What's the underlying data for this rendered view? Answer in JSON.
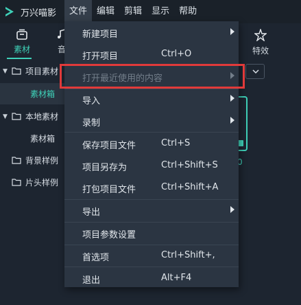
{
  "app": {
    "title": "万兴喵影",
    "logo_icon": "app-logo-icon"
  },
  "menubar": {
    "items": [
      {
        "label": "文件",
        "active": true
      },
      {
        "label": "编辑"
      },
      {
        "label": "剪辑"
      },
      {
        "label": "显示"
      },
      {
        "label": "帮助"
      }
    ]
  },
  "toolbar": {
    "tabs": [
      {
        "label": "素材",
        "icon": "media-box-icon",
        "active": true
      },
      {
        "label": "音",
        "icon": "music-note-icon"
      },
      {
        "label": "特效",
        "icon": "effects-star-icon"
      }
    ]
  },
  "sidebar": {
    "items": [
      {
        "label": "项目素材",
        "type": "parent"
      },
      {
        "label": "素材箱",
        "type": "child",
        "selected": true
      },
      {
        "label": "本地素材",
        "type": "parent"
      },
      {
        "label": "素材箱",
        "type": "child"
      },
      {
        "label": "背景样例",
        "type": "folder"
      },
      {
        "label": "片头样例",
        "type": "folder"
      }
    ]
  },
  "file_menu": {
    "items": [
      {
        "label": "新建项目",
        "shortcut": "",
        "submenu": true,
        "disabled": false
      },
      {
        "label": "打开项目",
        "shortcut": "Ctrl+O",
        "submenu": false,
        "disabled": false
      },
      {
        "label": "打开最近使用的内容",
        "shortcut": "",
        "submenu": true,
        "disabled": true
      },
      {
        "label": "导入",
        "shortcut": "",
        "submenu": true,
        "disabled": false
      },
      {
        "label": "录制",
        "shortcut": "",
        "submenu": true,
        "disabled": false
      },
      {
        "label": "保存项目文件",
        "shortcut": "Ctrl+S",
        "submenu": false,
        "disabled": false
      },
      {
        "label": "项目另存为",
        "shortcut": "Ctrl+Shift+S",
        "submenu": false,
        "disabled": false
      },
      {
        "label": "打包项目文件",
        "shortcut": "Ctrl+Shift+A",
        "submenu": false,
        "disabled": false
      },
      {
        "label": "导出",
        "shortcut": "",
        "submenu": true,
        "disabled": false
      },
      {
        "label": "项目参数设置",
        "shortcut": "",
        "submenu": false,
        "disabled": false
      },
      {
        "label": "首选项",
        "shortcut": "Ctrl+Shift+,",
        "submenu": false,
        "disabled": false
      },
      {
        "label": "退出",
        "shortcut": "Alt+F4",
        "submenu": false,
        "disabled": false
      }
    ]
  },
  "media_panel": {
    "clip_counter": "0"
  },
  "colors": {
    "accent": "#3fd2b9",
    "annotation_red": "#e23a3a",
    "menu_bg": "#2b3542"
  }
}
